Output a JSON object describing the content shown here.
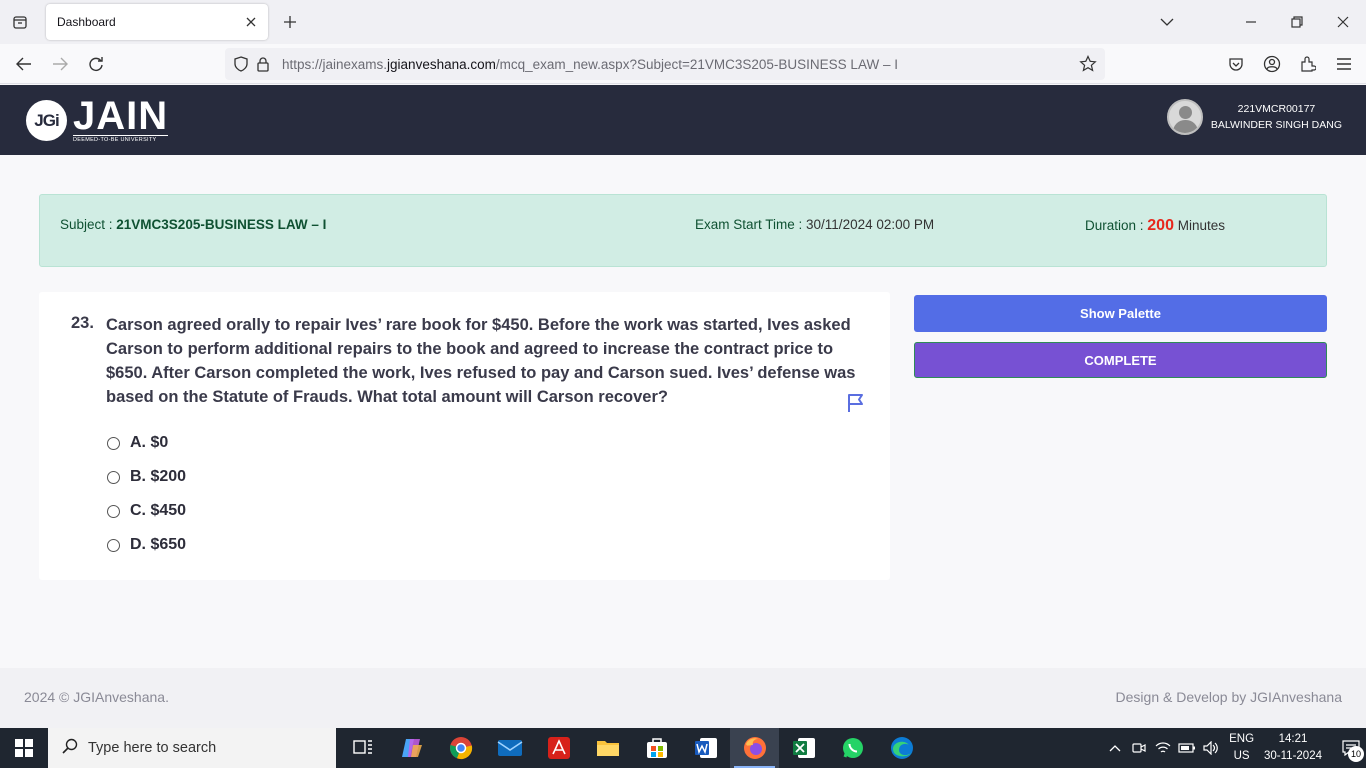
{
  "browser": {
    "tab_title": "Dashboard",
    "url_prefix": "https://jainexams.",
    "url_domain": "jgianveshana.com",
    "url_path": "/mcq_exam_new.aspx?Subject=21VMC3S205-BUSINESS LAW – I"
  },
  "header": {
    "logo_mark": "JGi",
    "logo_word": "JAIN",
    "logo_sub": "DEEMED-TO-BE UNIVERSITY",
    "user_id": "221VMCR00177",
    "user_name": "BALWINDER SINGH DANG"
  },
  "exam_info": {
    "subject_label": "Subject : ",
    "subject_value": "21VMC3S205-BUSINESS LAW – I",
    "start_label": "Exam Start Time : ",
    "start_value": "30/11/2024 02:00 PM",
    "duration_label": "Duration : ",
    "duration_value": "200",
    "duration_unit": " Minutes"
  },
  "question": {
    "number": "23.",
    "text": "Carson agreed orally to repair Ives’ rare book for $450. Before the work was started, Ives asked Carson to perform additional repairs to the book and agreed to increase the contract price to $650. After Carson completed the work, Ives refused to pay and Carson sued. Ives’ defense was based on the Statute of Frauds. What total amount will Carson recover?",
    "options": [
      {
        "label": "A. $0"
      },
      {
        "label": "B. $200"
      },
      {
        "label": "C. $450"
      },
      {
        "label": "D. $650"
      }
    ]
  },
  "actions": {
    "palette_label": "Show Palette",
    "complete_label": "COMPLETE"
  },
  "footer": {
    "left": "2024 © JGIAnveshana.",
    "right": "Design & Develop by JGIAnveshana"
  },
  "taskbar": {
    "search_placeholder": "Type here to search",
    "lang_top": "ENG",
    "lang_bottom": "US",
    "time": "14:21",
    "date": "30-11-2024",
    "notification_count": "10"
  },
  "colors": {
    "header_bg": "#272b3d",
    "info_bg": "#d1ede4",
    "palette_btn": "#536de6",
    "complete_btn": "#7751d3",
    "duration_accent": "#e7281d"
  }
}
